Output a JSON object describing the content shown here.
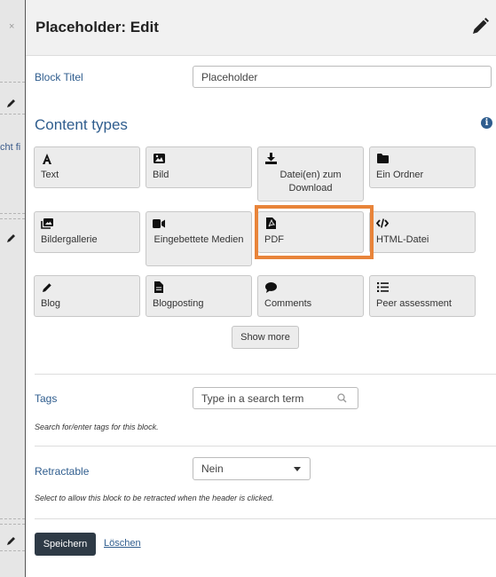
{
  "background": {
    "partial_text": "cht fi",
    "close_glyph": "×"
  },
  "dialog": {
    "title": "Placeholder: Edit"
  },
  "block_title": {
    "label": "Block Titel",
    "value": "Placeholder"
  },
  "content_types": {
    "heading": "Content types",
    "info_glyph": "i",
    "tiles": [
      {
        "icon": "text-icon",
        "label": "Text"
      },
      {
        "icon": "image-icon",
        "label": "Bild"
      },
      {
        "icon": "download-icon",
        "label": "Datei(en) zum Download"
      },
      {
        "icon": "folder-icon",
        "label": "Ein Ordner"
      },
      {
        "icon": "gallery-icon",
        "label": "Bildergallerie"
      },
      {
        "icon": "video-icon",
        "label": "Eingebettete Medien"
      },
      {
        "icon": "pdf-icon",
        "label": "PDF"
      },
      {
        "icon": "code-icon",
        "label": "HTML-Datei"
      },
      {
        "icon": "pencil-icon",
        "label": "Blog"
      },
      {
        "icon": "file-icon",
        "label": "Blogposting"
      },
      {
        "icon": "comment-icon",
        "label": "Comments"
      },
      {
        "icon": "list-icon",
        "label": "Peer assessment"
      }
    ],
    "show_more_label": "Show more"
  },
  "tags": {
    "label": "Tags",
    "placeholder": "Type in a search term",
    "help": "Search for/enter tags for this block."
  },
  "retractable": {
    "label": "Retractable",
    "selected": "Nein",
    "help": "Select to allow this block to be retracted when the header is clicked."
  },
  "actions": {
    "save_label": "Speichern",
    "delete_label": "Löschen"
  },
  "colors": {
    "accent_blue": "#2f5d8e",
    "highlight_orange": "#e8843a",
    "save_button": "#2e3a46"
  }
}
